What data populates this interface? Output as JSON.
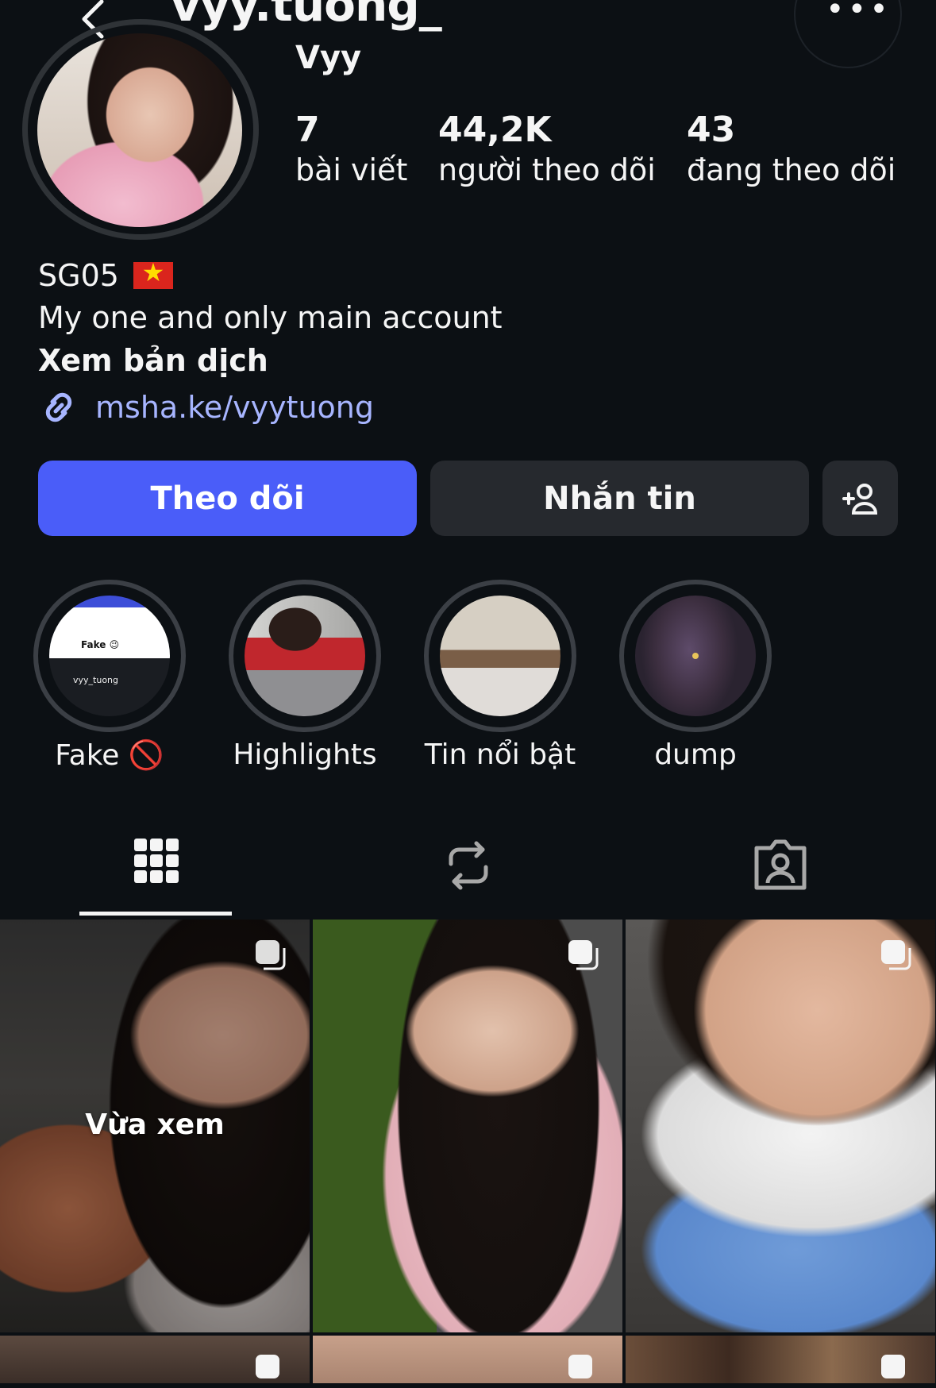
{
  "header": {
    "username": "vyy.tuong_",
    "display_name": "Vyy"
  },
  "stats": [
    {
      "value": "7",
      "label": "bài viết"
    },
    {
      "value": "44,2K",
      "label": "người theo dõi"
    },
    {
      "value": "43",
      "label": "đang theo dõi"
    }
  ],
  "bio": {
    "line1": "SG05",
    "line2": "My one and only main account",
    "translate": "Xem bản dịch",
    "link": "msha.ke/vyytuong"
  },
  "actions": {
    "follow": "Theo dõi",
    "message": "Nhắn tin"
  },
  "highlights": [
    {
      "label": "Fake 🚫"
    },
    {
      "label": "Highlights"
    },
    {
      "label": "Tin nổi bật"
    },
    {
      "label": "dump"
    }
  ],
  "highlight_fake_preview": {
    "title": "Fake 😉",
    "name": "vyy_tuong"
  },
  "tabs": [
    "grid-icon",
    "reposts-icon",
    "tagged-icon"
  ],
  "grid": {
    "recent_label": "Vừa xem"
  },
  "colors": {
    "background": "#0c1014",
    "follow_button": "#4a5df9",
    "secondary_button": "#26292e",
    "link": "#a7b5ff"
  }
}
